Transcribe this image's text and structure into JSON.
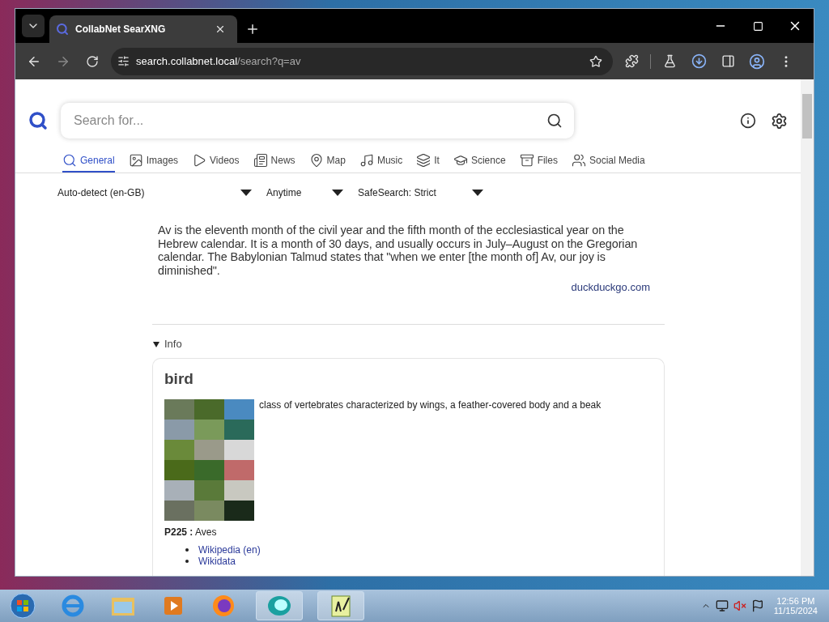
{
  "browser": {
    "tab": {
      "title": "CollabNet SearXNG"
    },
    "address": {
      "host": "search.collabnet.local",
      "path": "/search?q=av"
    }
  },
  "search": {
    "placeholder": "Search for..."
  },
  "categories": [
    {
      "label": "General",
      "selected": true
    },
    {
      "label": "Images",
      "selected": false
    },
    {
      "label": "Videos",
      "selected": false
    },
    {
      "label": "News",
      "selected": false
    },
    {
      "label": "Map",
      "selected": false
    },
    {
      "label": "Music",
      "selected": false
    },
    {
      "label": "It",
      "selected": false
    },
    {
      "label": "Science",
      "selected": false
    },
    {
      "label": "Files",
      "selected": false
    },
    {
      "label": "Social Media",
      "selected": false
    }
  ],
  "filters": [
    {
      "value": "Auto-detect (en-GB)"
    },
    {
      "value": "Anytime"
    },
    {
      "value": "SafeSearch: Strict"
    }
  ],
  "answer": {
    "text": "Av is the eleventh month of the civil year and the fifth month of the ecclesiastical year on the Hebrew calendar. It is a month of 30 days, and usually occurs in July–August on the Gregorian calendar. The Babylonian Talmud states that \"when we enter [the month of] Av, our joy is diminished\".",
    "source": "duckduckgo.com"
  },
  "infobox": {
    "toggle": "Info",
    "expanded": true,
    "title": "bird",
    "description": "class of vertebrates characterized by wings, a feather-covered body and a beak",
    "attributes": [
      {
        "label": "P225 :",
        "value": "Aves"
      }
    ],
    "links": [
      "Wikipedia (en)",
      "Wikidata"
    ]
  },
  "taskbar": {
    "time": "12:56 PM",
    "date": "11/15/2024"
  }
}
